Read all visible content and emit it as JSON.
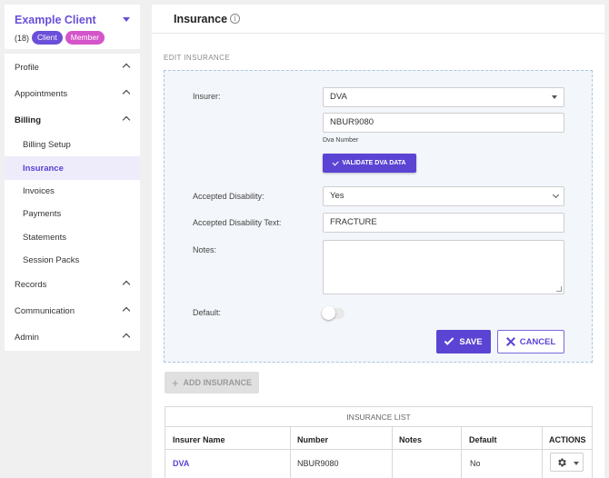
{
  "client": {
    "name": "Example Client",
    "count": "(18)",
    "badges": [
      "Client",
      "Member"
    ],
    "badge_colors": [
      "#6a4fd8",
      "#d455c9"
    ]
  },
  "sidebar": {
    "items": [
      {
        "label": "Profile"
      },
      {
        "label": "Appointments"
      },
      {
        "label": "Billing"
      },
      {
        "label": "Billing Setup"
      },
      {
        "label": "Insurance"
      },
      {
        "label": "Invoices"
      },
      {
        "label": "Payments"
      },
      {
        "label": "Statements"
      },
      {
        "label": "Session Packs"
      },
      {
        "label": "Records"
      },
      {
        "label": "Communication"
      },
      {
        "label": "Admin"
      }
    ],
    "active": "Insurance"
  },
  "page": {
    "title": "Insurance",
    "info_icon": "info-icon"
  },
  "form": {
    "section_title": "EDIT INSURANCE",
    "insurer_label": "Insurer:",
    "insurer_value": "DVA",
    "dva_number_value": "NBUR9080",
    "dva_number_helper": "Dva Number",
    "validate_button": "VALIDATE DVA DATA",
    "accepted_disability_label": "Accepted Disability:",
    "accepted_disability_value": "Yes",
    "accepted_disability_text_label": "Accepted Disability Text:",
    "accepted_disability_text_value": "FRACTURE",
    "notes_label": "Notes:",
    "notes_value": "",
    "default_label": "Default:",
    "default_on": false,
    "save_button": "SAVE",
    "cancel_button": "CANCEL"
  },
  "add_button": "ADD INSURANCE",
  "insurance_list": {
    "title": "INSURANCE LIST",
    "headers": [
      "Insurer Name",
      "Number",
      "Notes",
      "Default",
      "ACTIONS"
    ],
    "rows": [
      {
        "insurer": "DVA",
        "number": "NBUR9080",
        "notes": "",
        "default": "No"
      }
    ]
  },
  "colors": {
    "accent": "#5b44d4",
    "form_background": "#f3f6fa"
  }
}
